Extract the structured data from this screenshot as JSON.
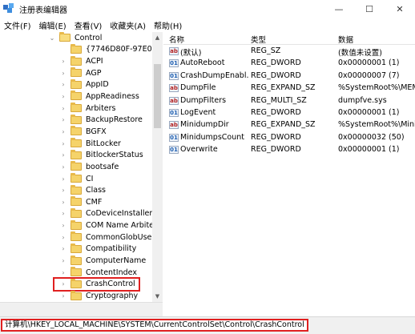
{
  "window": {
    "title": "注册表编辑器",
    "controls": {
      "minimize": "—",
      "maximize": "☐",
      "close": "✕"
    }
  },
  "menu": [
    "文件(F)",
    "编辑(E)",
    "查看(V)",
    "收藏夹(A)",
    "帮助(H)"
  ],
  "tree": {
    "root": "Control",
    "items": [
      "{7746D80F-97E0-4E2",
      "ACPI",
      "AGP",
      "AppID",
      "AppReadiness",
      "Arbiters",
      "BackupRestore",
      "BGFX",
      "BitLocker",
      "BitlockerStatus",
      "bootsafe",
      "CI",
      "Class",
      "CMF",
      "CoDeviceInstallers",
      "COM Name Arbiter",
      "CommonGlobUserSe",
      "Compatibility",
      "ComputerName",
      "ContentIndex",
      "CrashControl",
      "Cryptography"
    ],
    "selected": "CrashControl"
  },
  "list": {
    "headers": {
      "name": "名称",
      "type": "类型",
      "data": "数据"
    },
    "rows": [
      {
        "icon": "ab",
        "name": "(默认)",
        "type": "REG_SZ",
        "data": "(数值未设置)"
      },
      {
        "icon": "bin",
        "name": "AutoReboot",
        "type": "REG_DWORD",
        "data": "0x00000001 (1)"
      },
      {
        "icon": "bin",
        "name": "CrashDumpEnabl...",
        "type": "REG_DWORD",
        "data": "0x00000007 (7)"
      },
      {
        "icon": "ab",
        "name": "DumpFile",
        "type": "REG_EXPAND_SZ",
        "data": "%SystemRoot%\\MEMO"
      },
      {
        "icon": "ab",
        "name": "DumpFilters",
        "type": "REG_MULTI_SZ",
        "data": "dumpfve.sys"
      },
      {
        "icon": "bin",
        "name": "LogEvent",
        "type": "REG_DWORD",
        "data": "0x00000001 (1)"
      },
      {
        "icon": "ab",
        "name": "MinidumpDir",
        "type": "REG_EXPAND_SZ",
        "data": "%SystemRoot%\\Minid"
      },
      {
        "icon": "bin",
        "name": "MinidumpsCount",
        "type": "REG_DWORD",
        "data": "0x00000032 (50)"
      },
      {
        "icon": "bin",
        "name": "Overwrite",
        "type": "REG_DWORD",
        "data": "0x00000001 (1)"
      }
    ]
  },
  "status": {
    "path": "计算机\\HKEY_LOCAL_MACHINE\\SYSTEM\\CurrentControlSet\\Control\\CrashControl"
  }
}
